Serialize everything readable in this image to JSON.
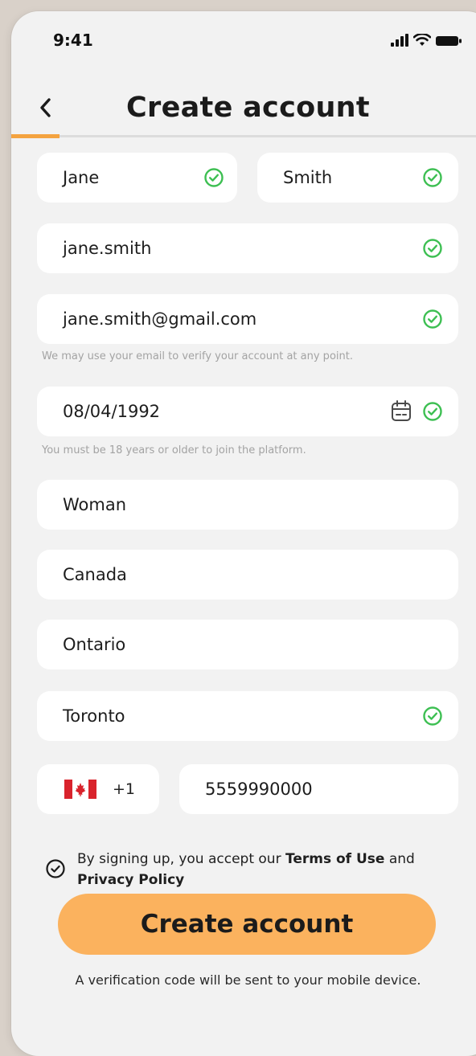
{
  "status_bar": {
    "time": "9:41"
  },
  "header": {
    "title": "Create account"
  },
  "progress": {
    "fraction": 0.1
  },
  "form": {
    "first_name": "Jane",
    "last_name": "Smith",
    "username": "jane.smith",
    "email": "jane.smith@gmail.com",
    "email_hint": "We may use your email to verify your account at any point.",
    "birthdate": "08/04/1992",
    "birthdate_hint": "You must be 18 years or older to join the platform.",
    "gender": "Woman",
    "country": "Canada",
    "province": "Ontario",
    "city": "Toronto",
    "phone_code": "+1",
    "phone_number": "5559990000"
  },
  "terms": {
    "prefix": "By signing up, you accept our ",
    "terms_link": "Terms of Use",
    "middle": " and ",
    "privacy_link": "Privacy Policy"
  },
  "cta": {
    "label": "Create account"
  },
  "footnote": "A verification code will be sent to your mobile device.",
  "colors": {
    "accent": "#f4a340",
    "button": "#fbb25e",
    "valid": "#3dbf52",
    "background": "#f2f2f2"
  },
  "icons": {
    "back": "chevron-left-icon",
    "valid": "check-circle-icon",
    "calendar": "calendar-icon",
    "terms": "check-circle-outline-icon",
    "flag": "canada-flag-icon"
  }
}
